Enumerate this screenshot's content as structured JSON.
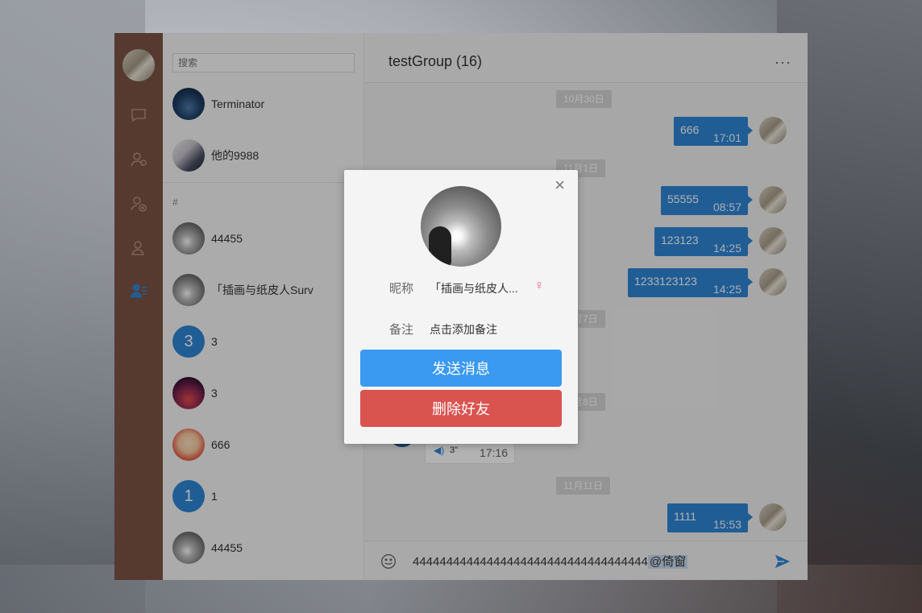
{
  "search": {
    "placeholder": "搜索"
  },
  "contacts": [
    {
      "name": "Terminator",
      "avatar_type": "image"
    },
    {
      "name": "他的9988",
      "avatar_type": "image"
    },
    {
      "section": "#"
    },
    {
      "name": "44455",
      "avatar_type": "image"
    },
    {
      "name": "「插画与纸皮人Surv",
      "avatar_type": "image"
    },
    {
      "name": "3",
      "avatar_type": "number",
      "avatar_text": "3"
    },
    {
      "name": "3",
      "avatar_type": "image"
    },
    {
      "name": "666",
      "avatar_type": "image"
    },
    {
      "name": "1",
      "avatar_type": "number",
      "avatar_text": "1"
    },
    {
      "name": "44455",
      "avatar_type": "image"
    }
  ],
  "chat": {
    "title": "testGroup (16)",
    "more": "···",
    "date_pills": [
      "10月30日",
      "11月1日",
      "月7日",
      "月8日",
      "11月11日"
    ],
    "messages": [
      {
        "text": "666",
        "time": "17:01"
      },
      {
        "text": "55555",
        "time": "08:57"
      },
      {
        "text": "123123",
        "time": "14:25"
      },
      {
        "text": "1233123123",
        "time": "14:25"
      },
      {
        "text": "1111",
        "time": "15:53"
      }
    ],
    "voice": {
      "duration": "3\"",
      "time": "17:16"
    },
    "composer": {
      "text": "44444444444444444444444444444444444",
      "mention": "@倚窗"
    }
  },
  "modal": {
    "close": "×",
    "nickname_label": "昵称",
    "nickname_value": "「插画与纸皮人...",
    "gender": "♀",
    "remark_label": "备注",
    "remark_value": "点击添加备注",
    "send_button": "发送消息",
    "delete_button": "删除好友"
  },
  "colors": {
    "rail": "#7b5446",
    "primary": "#2f86d6",
    "send_button": "#3a99f0",
    "delete_button": "#d9534f"
  }
}
